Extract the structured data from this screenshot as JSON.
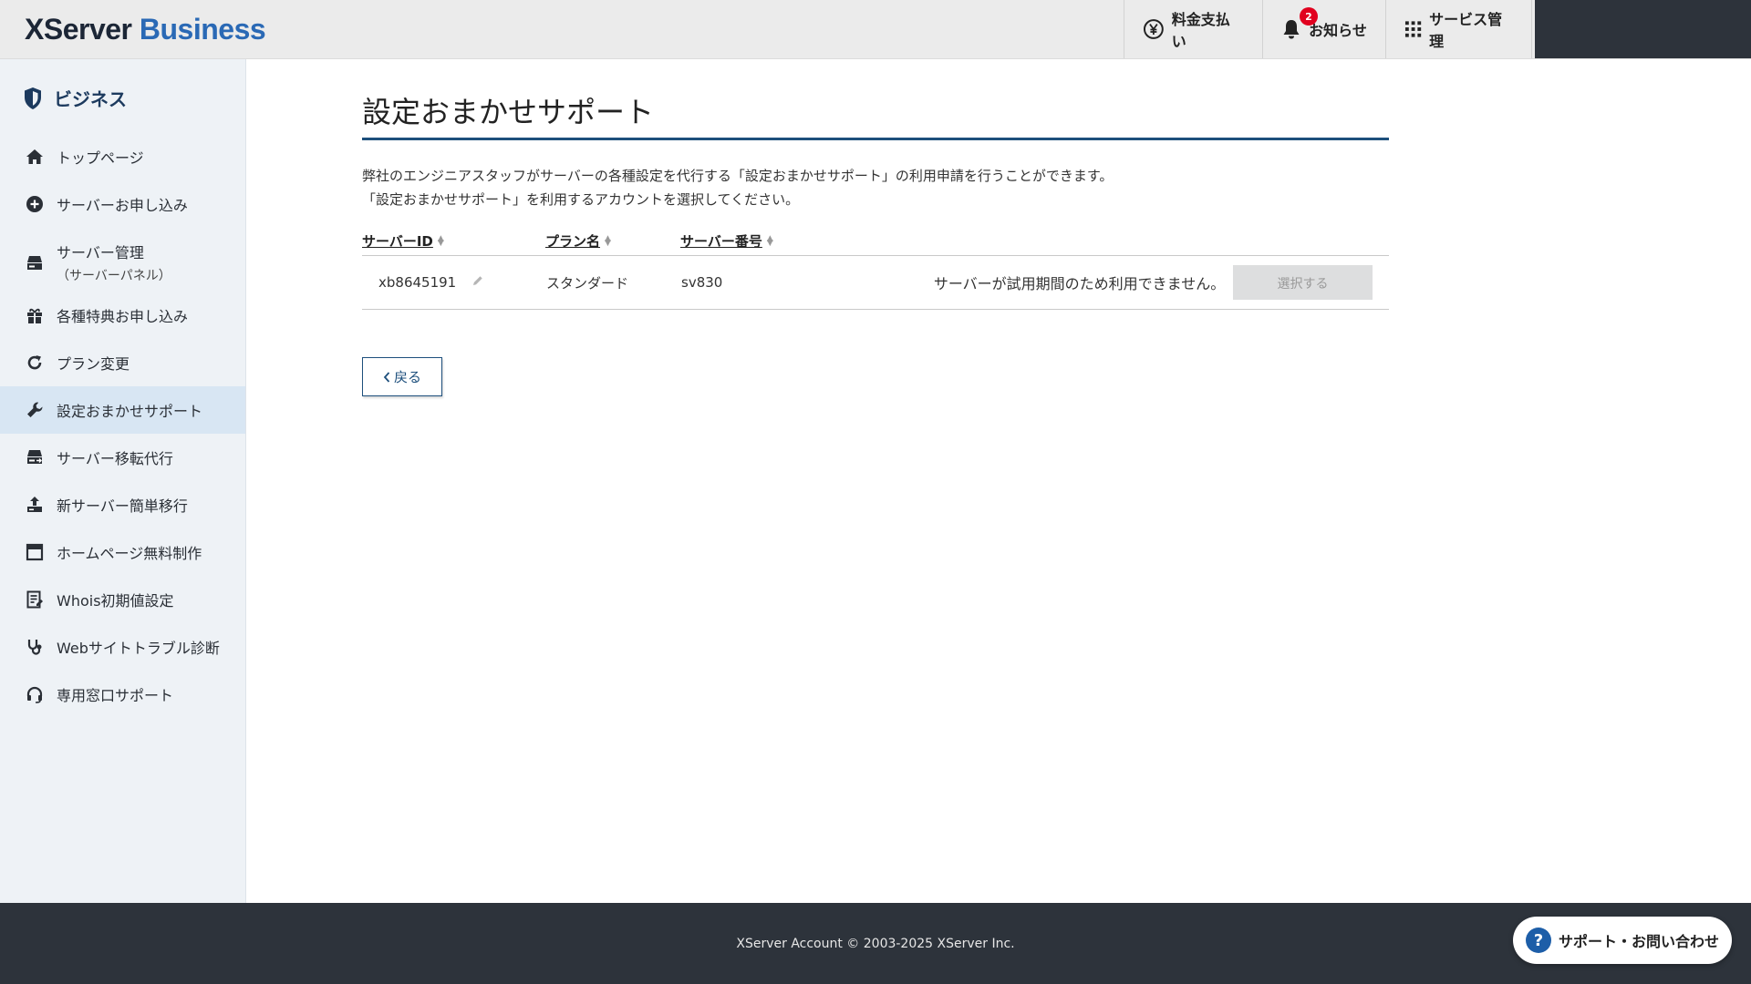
{
  "header": {
    "logo_part1": "XServer",
    "logo_part2": "Business",
    "payment_label": "料金支払い",
    "news_label": "お知らせ",
    "news_badge": "2",
    "service_label": "サービス管理"
  },
  "sidebar": {
    "title": "ビジネス",
    "items": [
      {
        "label": "トップページ",
        "icon": "home-icon"
      },
      {
        "label": "サーバーお申し込み",
        "icon": "plus-circle-icon"
      },
      {
        "label": "サーバー管理",
        "sub": "（サーバーパネル）",
        "icon": "server-icon"
      },
      {
        "label": "各種特典お申し込み",
        "icon": "gift-icon"
      },
      {
        "label": "プラン変更",
        "icon": "refresh-icon"
      },
      {
        "label": "設定おまかせサポート",
        "icon": "wrench-icon",
        "active": true
      },
      {
        "label": "サーバー移転代行",
        "icon": "server-move-icon"
      },
      {
        "label": "新サーバー簡単移行",
        "icon": "upload-icon"
      },
      {
        "label": "ホームページ無料制作",
        "icon": "window-icon"
      },
      {
        "label": "Whois初期値設定",
        "icon": "document-icon"
      },
      {
        "label": "Webサイトトラブル診断",
        "icon": "stethoscope-icon"
      },
      {
        "label": "専用窓口サポート",
        "icon": "headset-icon"
      }
    ]
  },
  "main": {
    "title": "設定おまかせサポート",
    "desc_line1": "弊社のエンジニアスタッフがサーバーの各種設定を代行する「設定おまかせサポート」の利用申請を行うことができます。",
    "desc_line2": "「設定おまかせサポート」を利用するアカウントを選択してください。",
    "table": {
      "headers": [
        "サーバーID",
        "プラン名",
        "サーバー番号"
      ],
      "rows": [
        {
          "server_id": "xb8645191",
          "plan": "スタンダード",
          "server_number": "sv830",
          "note": "サーバーが試用期間のため利用できません。",
          "button": "選択する"
        }
      ]
    },
    "back_label": "戻る"
  },
  "footer": {
    "copyright": "XServer Account © 2003-2025 XServer Inc.",
    "help_label": "サポート・お問い合わせ"
  },
  "colors": {
    "brand_dark": "#1c2636",
    "brand_blue": "#2a69b5",
    "accent_navy": "#1d4f7c",
    "badge_red": "#e1001e",
    "footer_bg": "#2d333b"
  }
}
